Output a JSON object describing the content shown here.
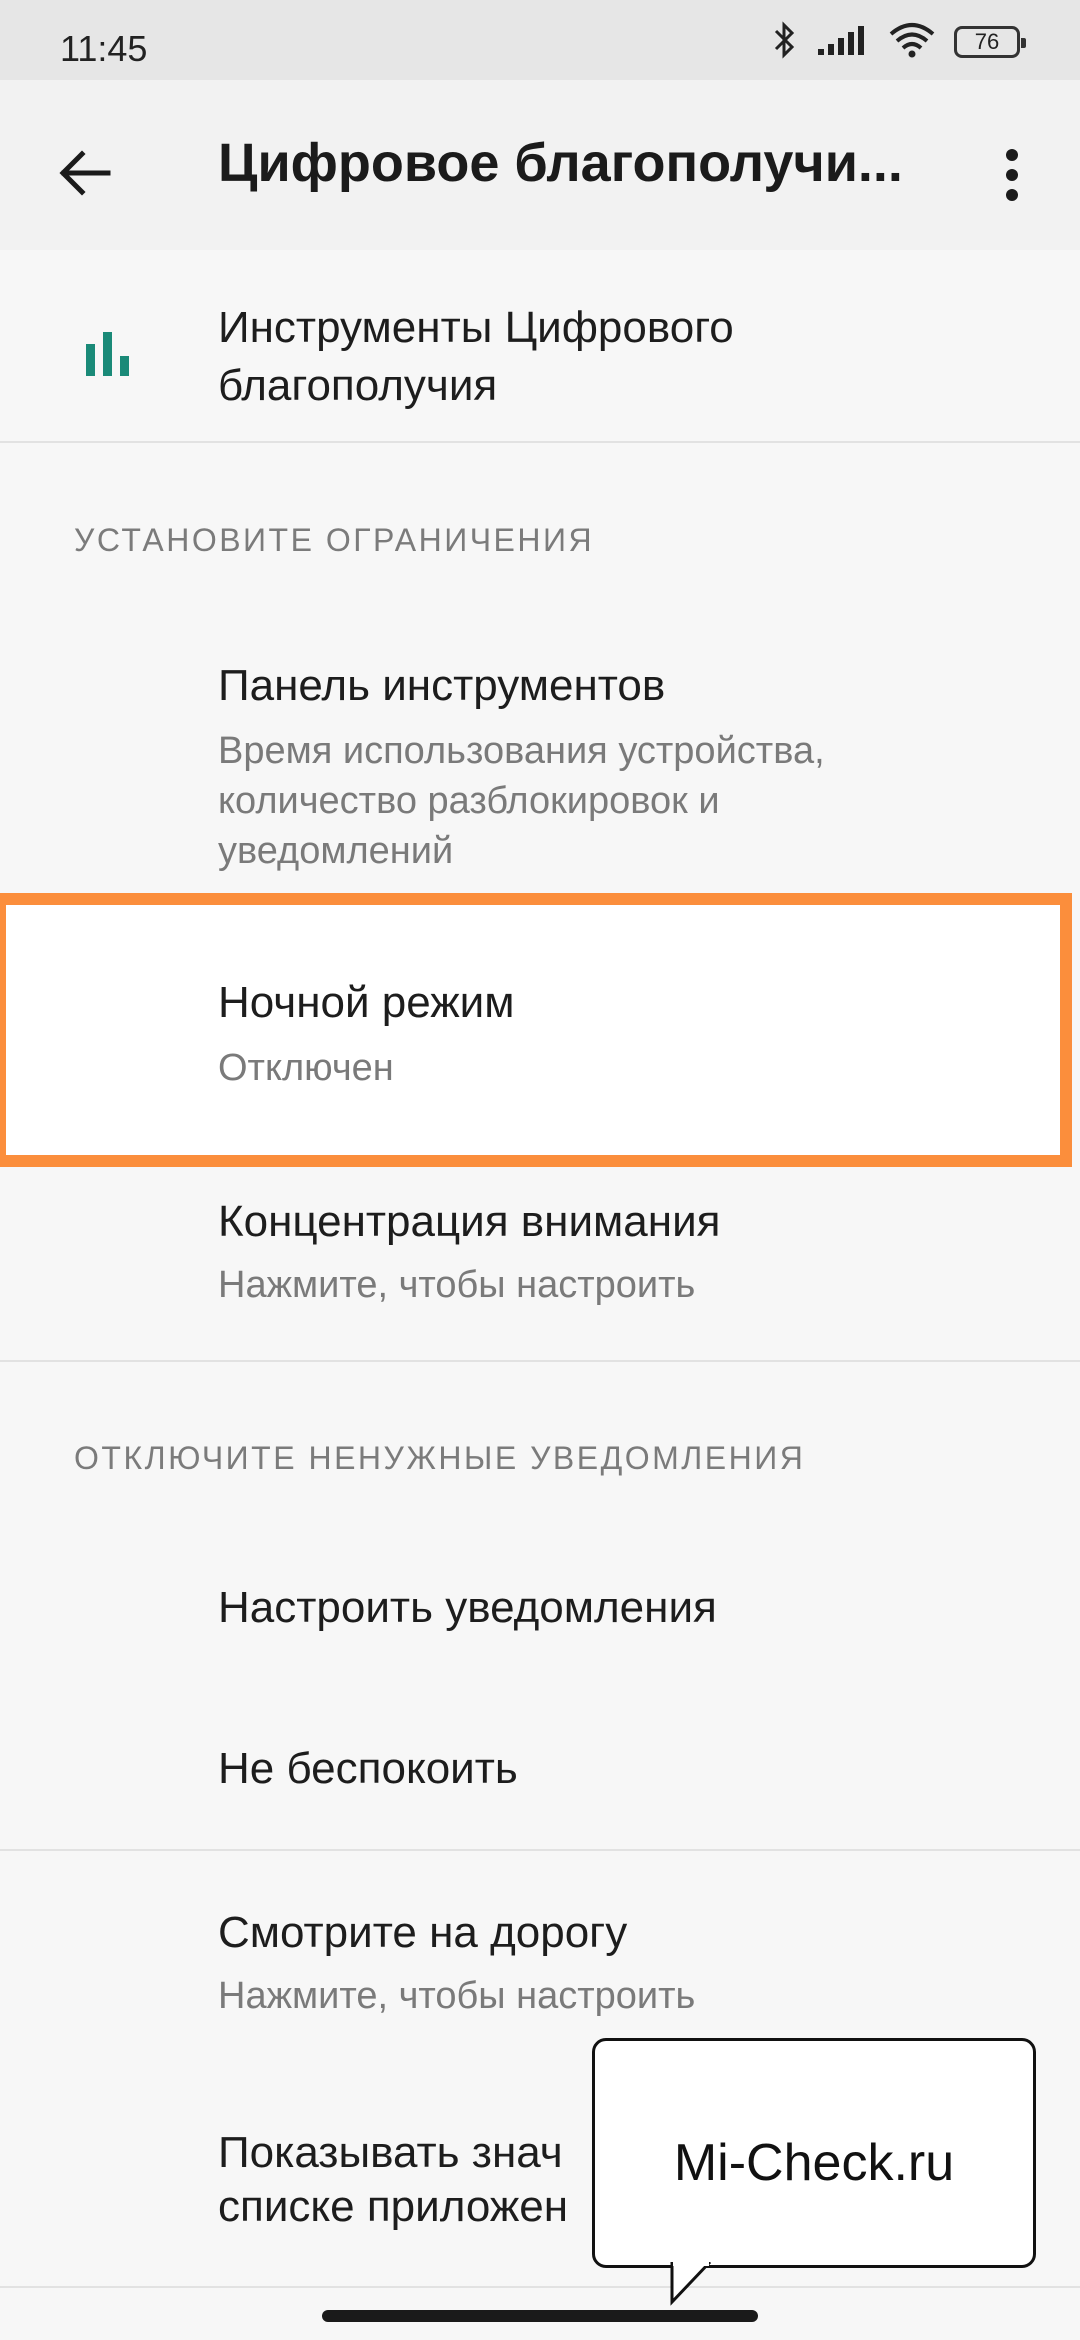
{
  "status_bar": {
    "time": "11:45",
    "battery": "76",
    "icons": [
      "bluetooth-icon",
      "signal-icon",
      "wifi-icon",
      "battery-icon"
    ]
  },
  "app_bar": {
    "title": "Цифровое благополучи...",
    "icons": [
      "back-arrow-icon",
      "more-vert-icon"
    ]
  },
  "tools_item": {
    "title_line1": "Инструменты Цифрового",
    "title_line2": "благополучия",
    "icon": "bar-chart-icon",
    "icon_color": "#1a8a78"
  },
  "section_limits": {
    "header": "УСТАНОВИТЕ ОГРАНИЧЕНИЯ",
    "items": [
      {
        "title": "Панель инструментов",
        "subtitle_lines": [
          "Время использования устройства,",
          "количество разблокировок и",
          "уведомлений"
        ]
      },
      {
        "title": "Ночной режим",
        "subtitle": "Отключен"
      },
      {
        "title": "Концентрация внимания",
        "subtitle": "Нажмите, чтобы настроить"
      }
    ]
  },
  "section_notifications": {
    "header": "ОТКЛЮЧИТЕ НЕНУЖНЫЕ УВЕДОМЛЕНИЯ",
    "items": [
      {
        "title": "Настроить уведомления"
      },
      {
        "title": "Не беспокоить"
      }
    ]
  },
  "other_items": [
    {
      "title": "Смотрите на дорогу",
      "subtitle": "Нажмите, чтобы настроить"
    },
    {
      "title_line1": "Показывать знач",
      "title_line2": "списке приложен"
    }
  ],
  "watermark": "Mi-Check.ru",
  "highlight_color": "#fb8e3c"
}
